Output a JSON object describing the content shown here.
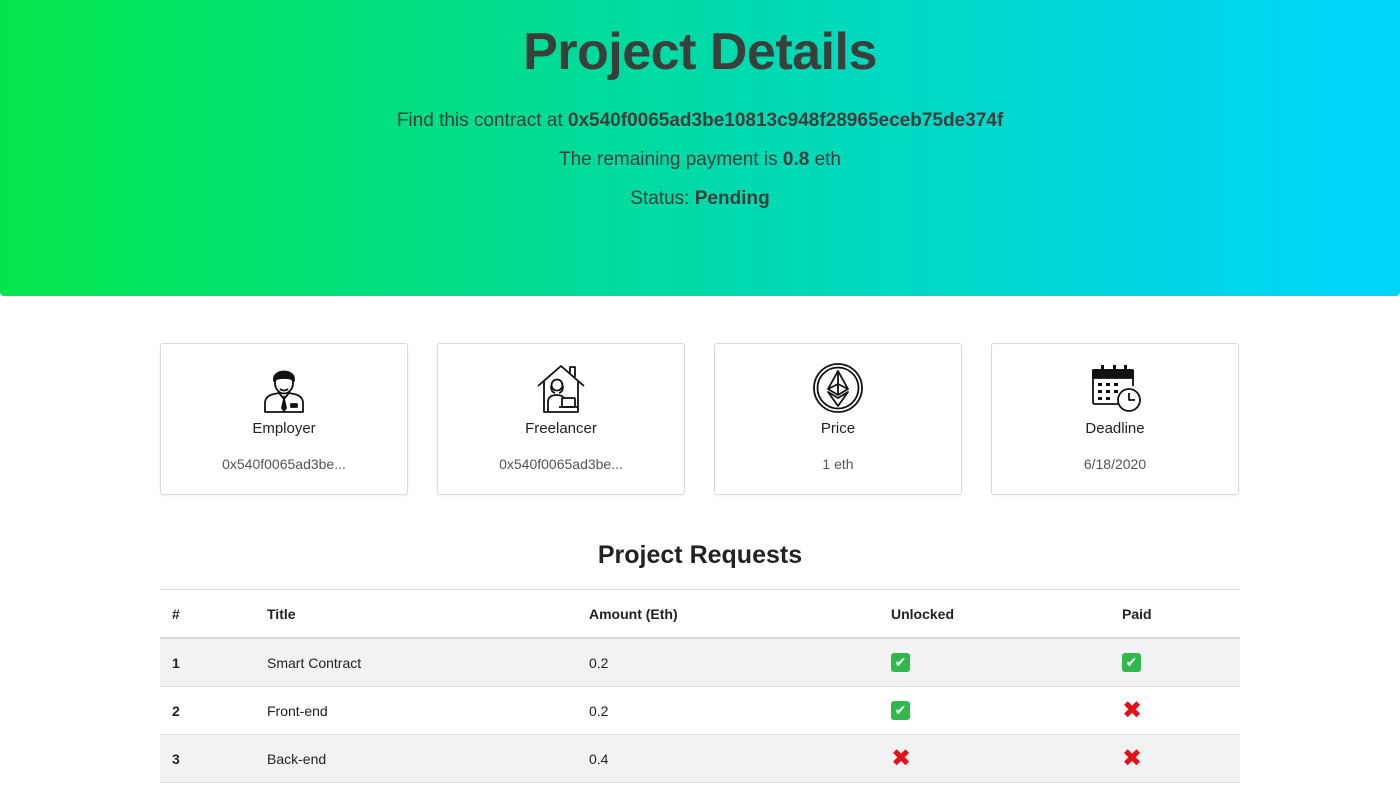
{
  "header": {
    "title": "Project Details",
    "contract_prefix": "Find this contract at",
    "contract_address": "0x540f0065ad3be10813c948f28965eceb75de374f",
    "payment_prefix": "The remaining payment is",
    "payment_amount": "0.8",
    "payment_unit": "eth",
    "status_label": "Status:",
    "status_value": "Pending"
  },
  "cards": [
    {
      "label": "Employer",
      "value": "0x540f0065ad3be...",
      "icon": "employer-icon"
    },
    {
      "label": "Freelancer",
      "value": "0x540f0065ad3be...",
      "icon": "freelancer-icon"
    },
    {
      "label": "Price",
      "value": "1 eth",
      "icon": "ethereum-icon"
    },
    {
      "label": "Deadline",
      "value": "6/18/2020",
      "icon": "calendar-icon"
    }
  ],
  "requests": {
    "title": "Project Requests",
    "columns": [
      "#",
      "Title",
      "Amount (Eth)",
      "Unlocked",
      "Paid"
    ],
    "rows": [
      {
        "num": "1",
        "title": "Smart Contract",
        "amount": "0.2",
        "unlocked": true,
        "paid": true
      },
      {
        "num": "2",
        "title": "Front-end",
        "amount": "0.2",
        "unlocked": true,
        "paid": false
      },
      {
        "num": "3",
        "title": "Back-end",
        "amount": "0.4",
        "unlocked": false,
        "paid": false
      }
    ]
  },
  "colors": {
    "gradient_start": "#00e64a",
    "gradient_end": "#00d4fb",
    "check_green": "#2fb84c",
    "cross_red": "#e5111a"
  }
}
